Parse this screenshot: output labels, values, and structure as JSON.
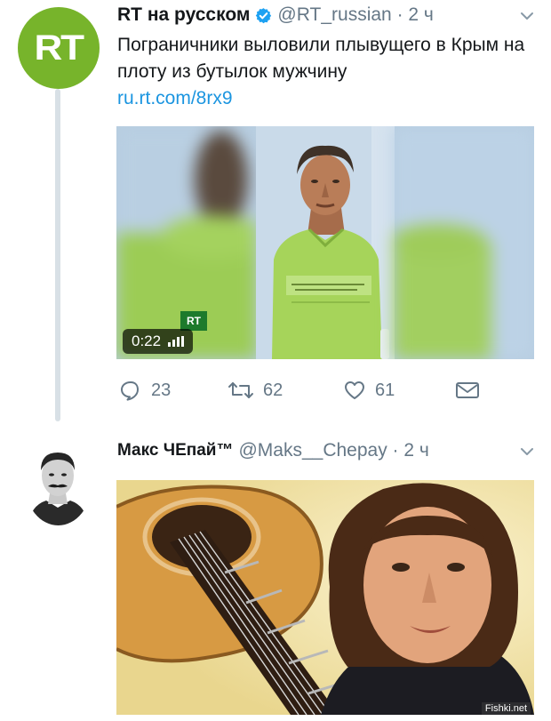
{
  "tweet1": {
    "author_name": "RT на русском",
    "handle_time": "@RT_russian · 2 ч",
    "avatar_text": "RT",
    "text": "Пограничники выловили плывущего в Крым на плоту из бутылок мужчину",
    "link": "ru.rt.com/8rx9",
    "video": {
      "duration": "0:22",
      "badge_text": "RT"
    },
    "actions": {
      "replies": "23",
      "retweets": "62",
      "likes": "61"
    },
    "icons": [
      "verified-badge-icon",
      "chevron-down-icon",
      "reply-icon",
      "retweet-icon",
      "like-icon",
      "message-icon",
      "volume-icon"
    ]
  },
  "tweet2": {
    "author_name": "Макс ЧЕпай™",
    "handle_time": "@Maks__Chepay · 2 ч"
  },
  "watermark": "Fishki.net",
  "colors": {
    "rt_green": "#77b42b",
    "link_blue": "#1b95e0",
    "verified_blue": "#1da1f2",
    "muted_gray": "#657786",
    "thread_line": "#d8e0e6"
  }
}
